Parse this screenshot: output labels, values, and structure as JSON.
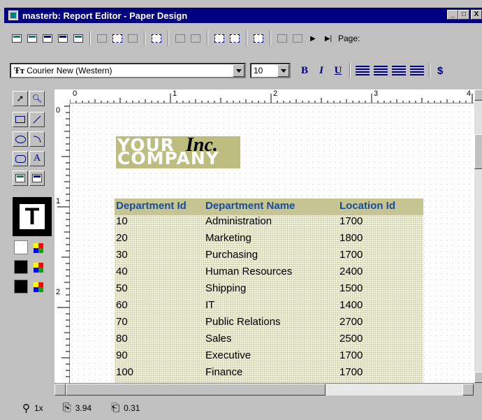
{
  "window": {
    "title": "masterb: Report Editor - Paper Design",
    "controls": [
      "_",
      "□",
      "X"
    ]
  },
  "toolbar1": {
    "buttons": [
      "new-report-icon",
      "open-icon",
      "edit-icon",
      "preview-icon",
      "layout-icon",
      "frame-icon",
      "field-icon",
      "body-icon",
      "select-parent-icon",
      "confine-icon",
      "flex-icon",
      "group-left-icon",
      "group-right-icon",
      "align-icon",
      "first-page-icon",
      "prev-page-icon",
      "next-page-icon",
      "last-page-icon"
    ],
    "page_label": "Page:"
  },
  "toolbar2": {
    "font_value": "Courier New (Western)",
    "font_type_glyph": "Ŧт",
    "size_value": "10",
    "bold": "B",
    "italic": "I",
    "underline": "U",
    "currency": "$"
  },
  "tool_palette": {
    "tools": [
      "select-arrow-icon",
      "magnify-icon",
      "rectangle-icon",
      "line-icon",
      "ellipse-icon",
      "arc-icon",
      "rounded-rect-icon",
      "text-icon",
      "field-icon",
      "report-block-icon"
    ],
    "text_tool_glyph": "T",
    "text_tool_label": "A"
  },
  "ruler": {
    "h_marks": [
      "0",
      "1",
      "2",
      "3",
      "4"
    ],
    "v_marks": [
      "0",
      "1",
      "2"
    ]
  },
  "logo": {
    "line1": "YOUR",
    "inc": "Inc.",
    "line2": "COMPANY"
  },
  "report": {
    "headers": [
      "Department Id",
      "Department Name",
      "Location Id"
    ],
    "rows": [
      [
        "10",
        "Administration",
        "1700"
      ],
      [
        "20",
        "Marketing",
        "1800"
      ],
      [
        "30",
        "Purchasing",
        "1700"
      ],
      [
        "40",
        "Human Resources",
        "2400"
      ],
      [
        "50",
        "Shipping",
        "1500"
      ],
      [
        "60",
        "IT",
        "1400"
      ],
      [
        "70",
        "Public Relations",
        "2700"
      ],
      [
        "80",
        "Sales",
        "2500"
      ],
      [
        "90",
        "Executive",
        "1700"
      ],
      [
        "100",
        "Finance",
        "1700"
      ]
    ]
  },
  "status": {
    "zoom": "1x",
    "x_pos": "3.94",
    "y_pos": "0.31"
  },
  "colors": {
    "title_bg": "#000080",
    "header_text": "#1c4b96",
    "header_bar": "#c5c594",
    "logo_bg": "#bdbd80"
  }
}
